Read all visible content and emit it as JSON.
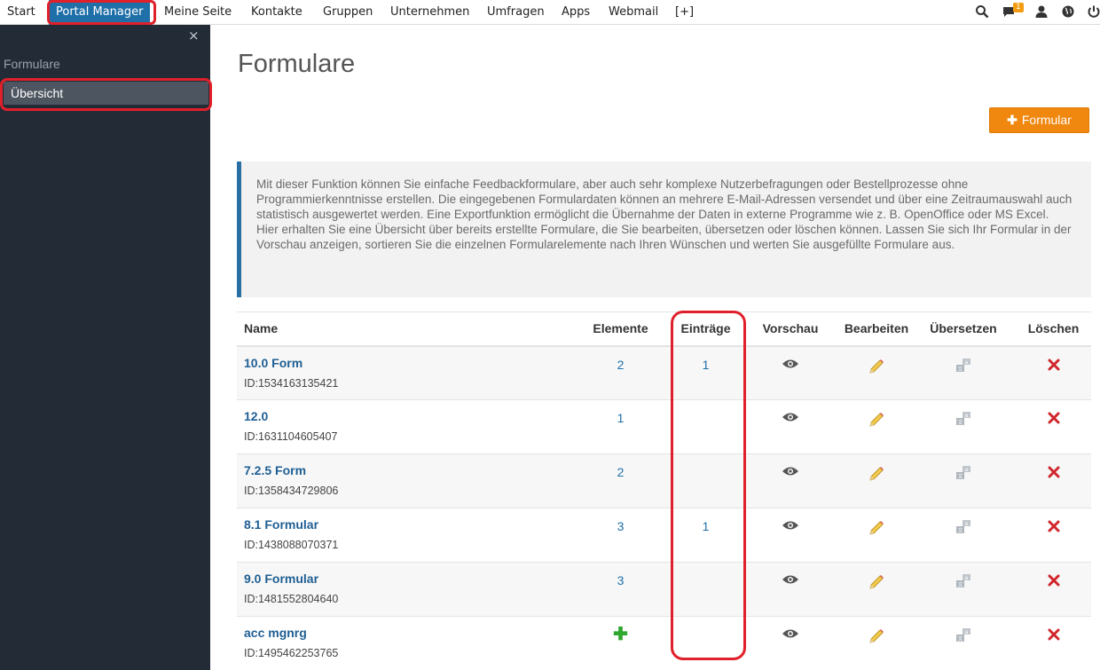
{
  "topnav": {
    "items": [
      "Start",
      "Portal Manager",
      "Meine Seite",
      "Kontakte",
      "Gruppen",
      "Unternehmen",
      "Umfragen",
      "Apps",
      "Webmail",
      "[+]"
    ],
    "notification_count": "1",
    "icons": [
      "search-icon",
      "messages-icon",
      "user-icon",
      "globe-icon",
      "power-icon"
    ]
  },
  "sidebar": {
    "close": "×",
    "section_title": "Formulare",
    "items": [
      {
        "label": "Übersicht",
        "active": true
      }
    ]
  },
  "main": {
    "title": "Formulare",
    "add_button_label": "Formular",
    "info_text_1": "Mit dieser Funktion können Sie einfache Feedbackformulare, aber auch sehr komplexe Nutzerbefragungen oder Bestellprozesse ohne Programmierkenntnisse erstellen. Die eingegebenen Formulardaten können an mehrere E-Mail-Adressen versendet und über eine Zeitraumauswahl auch statistisch ausgewertet werden. Eine Exportfunktion ermöglicht die Übernahme der Daten in externe Programme wie z. B. OpenOffice oder MS Excel.",
    "info_text_2": "Hier erhalten Sie eine Übersicht über bereits erstellte Formulare, die Sie bearbeiten, übersetzen oder löschen können. Lassen Sie sich Ihr Formular in der Vorschau anzeigen, sortieren Sie die einzelnen Formularelemente nach Ihren Wünschen und werten Sie ausgefüllte Formulare aus."
  },
  "table": {
    "headers": [
      "Name",
      "Elemente",
      "Einträge",
      "Vorschau",
      "Bearbeiten",
      "Übersetzen",
      "Löschen"
    ],
    "rows": [
      {
        "name": "10.0 Form",
        "id": "ID:1534163135421",
        "elemente": "2",
        "eintraege": "1"
      },
      {
        "name": "12.0",
        "id": "ID:1631104605407",
        "elemente": "1",
        "eintraege": ""
      },
      {
        "name": "7.2.5 Form",
        "id": "ID:1358434729806",
        "elemente": "2",
        "eintraege": ""
      },
      {
        "name": "8.1 Formular",
        "id": "ID:1438088070371",
        "elemente": "3",
        "eintraege": "1"
      },
      {
        "name": "9.0 Formular",
        "id": "ID:1481552804640",
        "elemente": "3",
        "eintraege": ""
      },
      {
        "name": "acc mgnrg",
        "id": "ID:1495462253765",
        "elemente": "+",
        "eintraege": ""
      }
    ]
  },
  "colors": {
    "nav_active": "#1f6fa8",
    "sidebar_bg": "#222b36",
    "accent_orange": "#f0870f",
    "highlight_red": "#e0202a",
    "link_blue": "#1f5f93"
  }
}
